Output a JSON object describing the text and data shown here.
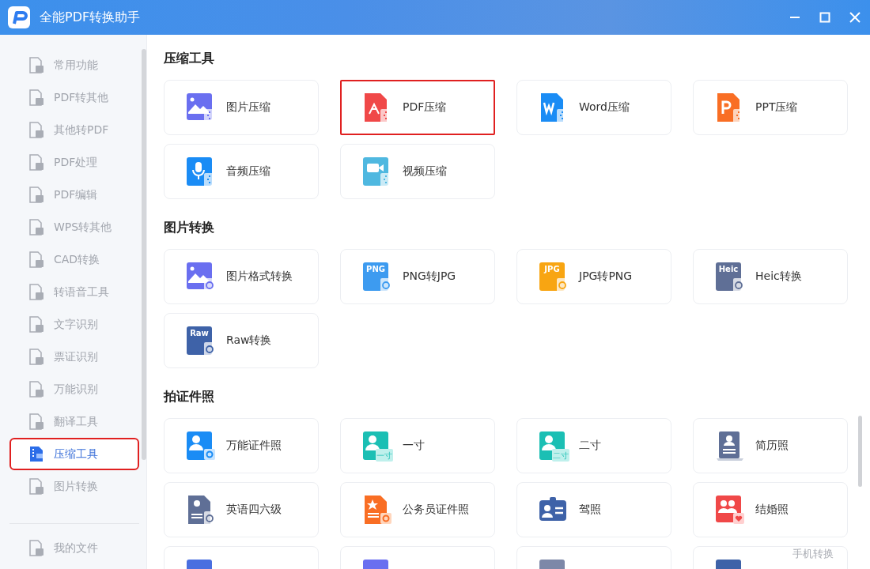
{
  "window": {
    "title": "全能PDF转换助手"
  },
  "sidebar": {
    "items": [
      {
        "label": "常用功能",
        "selected": false
      },
      {
        "label": "PDF转其他",
        "selected": false
      },
      {
        "label": "其他转PDF",
        "selected": false
      },
      {
        "label": "PDF处理",
        "selected": false
      },
      {
        "label": "PDF编辑",
        "selected": false
      },
      {
        "label": "WPS转其他",
        "selected": false
      },
      {
        "label": "CAD转换",
        "selected": false
      },
      {
        "label": "转语音工具",
        "selected": false
      },
      {
        "label": "文字识别",
        "selected": false
      },
      {
        "label": "票证识别",
        "selected": false
      },
      {
        "label": "万能识别",
        "selected": false
      },
      {
        "label": "翻译工具",
        "selected": false
      },
      {
        "label": "压缩工具",
        "selected": true
      },
      {
        "label": "图片转换",
        "selected": false
      }
    ],
    "footer_item": {
      "label": "我的文件"
    }
  },
  "sections": [
    {
      "title": "压缩工具",
      "cards": [
        {
          "label": "图片压缩",
          "kind": "picture",
          "color": "#6a6ff0",
          "highlighted": false
        },
        {
          "label": "PDF压缩",
          "kind": "pdf",
          "color": "#f04848",
          "highlighted": true
        },
        {
          "label": "Word压缩",
          "kind": "word",
          "color": "#1a8cf5",
          "highlighted": false
        },
        {
          "label": "PPT压缩",
          "kind": "ppt",
          "color": "#f96e24",
          "highlighted": false
        },
        {
          "label": "音频压缩",
          "kind": "mic",
          "color": "#1a8cf5",
          "highlighted": false
        },
        {
          "label": "视频压缩",
          "kind": "video",
          "color": "#4fb8e0",
          "highlighted": false
        }
      ]
    },
    {
      "title": "图片转换",
      "cards": [
        {
          "label": "图片格式转换",
          "kind": "picture",
          "color": "#6a6ff0",
          "highlighted": false
        },
        {
          "label": "PNG转JPG",
          "kind": "tag",
          "icon_text": "PNG",
          "color": "#3d9bf0",
          "highlighted": false
        },
        {
          "label": "JPG转PNG",
          "kind": "tag",
          "icon_text": "JPG",
          "color": "#f8a512",
          "highlighted": false
        },
        {
          "label": "Heic转换",
          "kind": "tag",
          "icon_text": "Heic",
          "color": "#5f6f96",
          "highlighted": false
        },
        {
          "label": "Raw转换",
          "kind": "tag",
          "icon_text": "Raw",
          "color": "#3e62a8",
          "highlighted": false
        }
      ]
    },
    {
      "title": "拍证件照",
      "cards": [
        {
          "label": "万能证件照",
          "kind": "person",
          "color": "#1a8cf5",
          "highlighted": false
        },
        {
          "label": "一寸",
          "kind": "person",
          "badge_text": "一寸",
          "color": "#1bbfb4",
          "highlighted": false
        },
        {
          "label": "二寸",
          "kind": "person",
          "badge_text": "二寸",
          "color": "#1bbfb4",
          "highlighted": false
        },
        {
          "label": "简历照",
          "kind": "resume",
          "color": "#5f6f96",
          "highlighted": false
        },
        {
          "label": "英语四六级",
          "kind": "doc-person",
          "color": "#5f6f96",
          "highlighted": false
        },
        {
          "label": "公务员证件照",
          "kind": "doc-star",
          "color": "#f96e24",
          "highlighted": false
        },
        {
          "label": "驾照",
          "kind": "id-card",
          "color": "#3e62a8",
          "highlighted": false
        },
        {
          "label": "结婚照",
          "kind": "couple",
          "color": "#f04848",
          "highlighted": false
        },
        {
          "kind": "partial",
          "color": "#4a6fe0",
          "highlighted": false
        },
        {
          "kind": "partial",
          "color": "#6a6ff0",
          "highlighted": false
        },
        {
          "kind": "partial",
          "color": "#7d88a8",
          "highlighted": false
        },
        {
          "kind": "partial",
          "color": "#3e62a8",
          "highlighted": false
        }
      ]
    }
  ],
  "floating_link": "手机转换"
}
